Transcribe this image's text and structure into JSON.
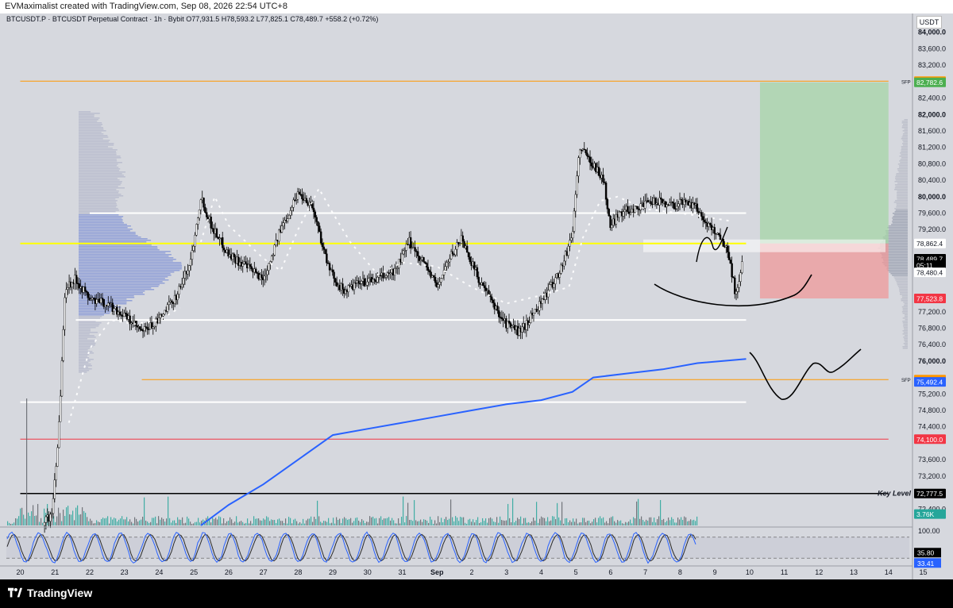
{
  "header": {
    "credit": "EVMaximalist created with TradingView.com, Sep 08, 2026 22:54 UTC+8",
    "legend": "BTCUSDT.P · BTCUSDT Perpetual Contract · 1h · Bybit  O77,931.5  H78,593.2  L77,825.1  C78,489.7  +558.2 (+0.72%)",
    "currency": "USDT"
  },
  "footer": {
    "brand": "TradingView"
  },
  "colors": {
    "background": "#d6d8de",
    "candle_up": "#ffffff",
    "candle_down": "#000000",
    "vwap_blue": "#2962ff",
    "resistance_yellow": "#ffff00",
    "red_line": "#f23645",
    "orange_line": "#ff9800",
    "volume_green": "#26a69a",
    "profit_zone": "#a5d6a7",
    "loss_zone": "#ef9a9a",
    "volume_profile": "#8c9bd6"
  },
  "chart_data": {
    "type": "candlestick",
    "title": "BTCUSDT.P · BTCUSDT Perpetual Contract · 1h · Bybit",
    "x_ticks": [
      "20",
      "21",
      "22",
      "23",
      "24",
      "25",
      "26",
      "27",
      "28",
      "29",
      "30",
      "31",
      "Sep",
      "2",
      "3",
      "4",
      "5",
      "6",
      "7",
      "8",
      "9",
      "10",
      "11",
      "12",
      "13",
      "14",
      "15"
    ],
    "y_ticks": [
      "84,000.0",
      "83,600.0",
      "83,200.0",
      "82,400.0",
      "82,000.0",
      "81,600.0",
      "81,200.0",
      "80,800.0",
      "80,400.0",
      "80,000.0",
      "79,600.0",
      "79,200.0",
      "77,200.0",
      "76,800.0",
      "76,400.0",
      "76,000.0",
      "75,200.0",
      "74,800.0",
      "74,400.0",
      "73,600.0",
      "73,200.0",
      "72,400.0"
    ],
    "ylim": [
      72000,
      84400
    ],
    "price_path": [
      [
        20,
        72000
      ],
      [
        20.9,
        72200
      ],
      [
        21.1,
        74200
      ],
      [
        21.3,
        77800
      ],
      [
        21.6,
        78000
      ],
      [
        22,
        77500
      ],
      [
        22.5,
        77400
      ],
      [
        23,
        77100
      ],
      [
        23.5,
        76700
      ],
      [
        24,
        77000
      ],
      [
        24.5,
        77600
      ],
      [
        24.9,
        78400
      ],
      [
        25.2,
        80000
      ],
      [
        25.5,
        79300
      ],
      [
        26,
        78600
      ],
      [
        26.5,
        78300
      ],
      [
        27,
        78000
      ],
      [
        27.5,
        79200
      ],
      [
        28,
        80100
      ],
      [
        28.4,
        79800
      ],
      [
        28.9,
        78200
      ],
      [
        29.3,
        77700
      ],
      [
        29.8,
        77900
      ],
      [
        30.3,
        78000
      ],
      [
        30.8,
        78200
      ],
      [
        31.2,
        78900
      ],
      [
        31.7,
        78300
      ],
      [
        32,
        77800
      ],
      [
        32.3,
        78400
      ],
      [
        32.7,
        79000
      ],
      [
        33.2,
        78000
      ],
      [
        33.6,
        77400
      ],
      [
        34,
        76900
      ],
      [
        34.4,
        76700
      ],
      [
        34.8,
        77200
      ],
      [
        35.2,
        77700
      ],
      [
        35.6,
        78300
      ],
      [
        35.9,
        79100
      ],
      [
        36.1,
        81200
      ],
      [
        36.5,
        80800
      ],
      [
        36.8,
        80400
      ],
      [
        37,
        79200
      ],
      [
        37.2,
        79600
      ],
      [
        37.6,
        79700
      ],
      [
        38,
        79800
      ],
      [
        38.4,
        79900
      ],
      [
        38.8,
        79800
      ],
      [
        39.2,
        79900
      ],
      [
        39.5,
        79700
      ],
      [
        39.8,
        79300
      ],
      [
        40.1,
        79100
      ],
      [
        40.4,
        78600
      ],
      [
        40.6,
        77600
      ],
      [
        40.8,
        78400
      ]
    ],
    "vwap": [
      [
        25.2,
        72000
      ],
      [
        26,
        72500
      ],
      [
        27,
        73000
      ],
      [
        28,
        73600
      ],
      [
        29,
        74200
      ],
      [
        30,
        74350
      ],
      [
        31,
        74500
      ],
      [
        32,
        74650
      ],
      [
        33,
        74800
      ],
      [
        34,
        74950
      ],
      [
        35,
        75050
      ],
      [
        35.9,
        75250
      ],
      [
        36.5,
        75600
      ],
      [
        37.5,
        75700
      ],
      [
        38.5,
        75800
      ],
      [
        39.5,
        75950
      ],
      [
        40.9,
        76050
      ]
    ],
    "horizontal_levels": [
      {
        "price": 82811.0,
        "label": "82,811.0",
        "tag": "SFP",
        "color": "#ff9800",
        "badge_fill": "#ff9800",
        "badge_text": "#000000",
        "from_day": 20,
        "to_day": 45,
        "width": 1
      },
      {
        "price": 79600.0,
        "label": "",
        "tag": "",
        "color": "#ffffff",
        "from_day": 22,
        "to_day": 40.9,
        "width": 2
      },
      {
        "price": 78862.4,
        "label": "78,862.4",
        "tag": "",
        "color": "#ffff00",
        "badge_fill": "#ffffff",
        "badge_text": "#131722",
        "from_day": 20,
        "to_day": 40.9,
        "width": 2
      },
      {
        "price": 77000.0,
        "label": "",
        "tag": "",
        "color": "#ffffff",
        "from_day": 21.6,
        "to_day": 40.9,
        "width": 2
      },
      {
        "price": 75550.0,
        "label": "75,550.0",
        "tag": "SFP",
        "color": "#ff9800",
        "badge_fill": "#ff9800",
        "badge_text": "#000000",
        "from_day": 23.5,
        "to_day": 45,
        "width": 1
      },
      {
        "price": 75000.0,
        "label": "",
        "tag": "",
        "color": "#ffffff",
        "from_day": 20,
        "to_day": 40.9,
        "width": 2
      },
      {
        "price": 74100.0,
        "label": "74,100.0",
        "tag": "",
        "color": "#f23645",
        "badge_fill": "#f23645",
        "badge_text": "#ffffff",
        "from_day": 20,
        "to_day": 45,
        "width": 1
      },
      {
        "price": 72777.5,
        "label": "72,777.5",
        "tag": "Key Level",
        "color": "#000000",
        "badge_fill": "#000000",
        "badge_text": "#ffffff",
        "from_day": 20,
        "to_day": 45,
        "width": 1.5
      }
    ],
    "price_badges": [
      {
        "price": 82782.6,
        "label": "82,782.6",
        "fill": "#4caf50",
        "text": "#ffffff"
      },
      {
        "price": 78489.7,
        "label": "78,489.7",
        "fill": "#000000",
        "text": "#ffffff"
      },
      {
        "price": 78340,
        "label": "05:11",
        "fill": "#000000",
        "text": "#ffffff"
      },
      {
        "price": 78160,
        "label": "78,480.4",
        "fill": "#ffffff",
        "text": "#131722"
      },
      {
        "price": 77523.8,
        "label": "77,523.8",
        "fill": "#f23645",
        "text": "#ffffff"
      },
      {
        "price": 75492.4,
        "label": "75,492.4",
        "fill": "#2962ff",
        "text": "#ffffff"
      },
      {
        "price": 72277,
        "label": "3.76K",
        "fill": "#26a69a",
        "text": "#ffffff"
      }
    ],
    "position": {
      "entry": 78862.4,
      "target": 82782.6,
      "stop": 77523.8,
      "from_day": 41.3,
      "to_day": 45.0
    },
    "oscillator": {
      "ticks": [
        "100.00",
        "35.80",
        "33.41"
      ],
      "levels": [
        100,
        80,
        20
      ],
      "k_last": 35.8,
      "d_last": 33.41
    }
  }
}
